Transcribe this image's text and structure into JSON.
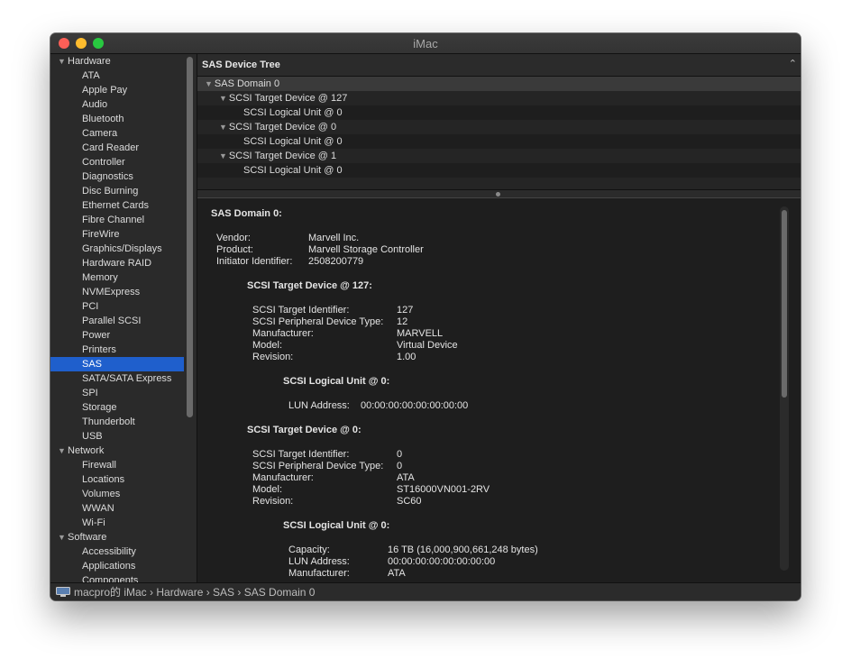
{
  "window": {
    "title": "iMac"
  },
  "sidebar": {
    "rows": [
      {
        "label": "Hardware",
        "group": true
      },
      {
        "label": "ATA"
      },
      {
        "label": "Apple Pay"
      },
      {
        "label": "Audio"
      },
      {
        "label": "Bluetooth"
      },
      {
        "label": "Camera"
      },
      {
        "label": "Card Reader"
      },
      {
        "label": "Controller"
      },
      {
        "label": "Diagnostics"
      },
      {
        "label": "Disc Burning"
      },
      {
        "label": "Ethernet Cards"
      },
      {
        "label": "Fibre Channel"
      },
      {
        "label": "FireWire"
      },
      {
        "label": "Graphics/Displays"
      },
      {
        "label": "Hardware RAID"
      },
      {
        "label": "Memory"
      },
      {
        "label": "NVMExpress"
      },
      {
        "label": "PCI"
      },
      {
        "label": "Parallel SCSI"
      },
      {
        "label": "Power"
      },
      {
        "label": "Printers"
      },
      {
        "label": "SAS",
        "selected": true
      },
      {
        "label": "SATA/SATA Express"
      },
      {
        "label": "SPI"
      },
      {
        "label": "Storage"
      },
      {
        "label": "Thunderbolt"
      },
      {
        "label": "USB"
      },
      {
        "label": "Network",
        "group": true
      },
      {
        "label": "Firewall"
      },
      {
        "label": "Locations"
      },
      {
        "label": "Volumes"
      },
      {
        "label": "WWAN"
      },
      {
        "label": "Wi-Fi"
      },
      {
        "label": "Software",
        "group": true
      },
      {
        "label": "Accessibility"
      },
      {
        "label": "Applications"
      },
      {
        "label": "Components"
      }
    ]
  },
  "tree": {
    "header": "SAS Device Tree",
    "rows": [
      {
        "label": "SAS Domain 0",
        "level": 0,
        "expanded": true
      },
      {
        "label": "SCSI Target Device @ 127",
        "level": 1,
        "expanded": true
      },
      {
        "label": "SCSI Logical Unit @ 0",
        "level": 2
      },
      {
        "label": "SCSI Target Device @ 0",
        "level": 1,
        "expanded": true
      },
      {
        "label": "SCSI Logical Unit @ 0",
        "level": 2
      },
      {
        "label": "SCSI Target Device @ 1",
        "level": 1,
        "expanded": true
      },
      {
        "label": "SCSI Logical Unit @ 0",
        "level": 2
      }
    ]
  },
  "detail": {
    "lines": [
      {
        "text": "SAS Domain 0:",
        "bold": true,
        "indent": 0
      },
      {
        "text": "Vendor:",
        "value": "Marvell Inc.",
        "indent": 1,
        "col": 1
      },
      {
        "text": "Product:",
        "value": "Marvell Storage Controller",
        "indent": 1,
        "col": 1
      },
      {
        "text": "Initiator Identifier:",
        "value": "2508200779",
        "indent": 1,
        "col": 1
      },
      {
        "text": "SCSI Target Device @ 127:",
        "bold": true,
        "indent": 2
      },
      {
        "text": "SCSI Target Identifier:",
        "value": "127",
        "indent": 3,
        "col": 2
      },
      {
        "text": "SCSI Peripheral Device Type:",
        "value": "12",
        "indent": 3,
        "col": 2
      },
      {
        "text": "Manufacturer:",
        "value": "MARVELL",
        "indent": 3,
        "col": 2
      },
      {
        "text": "Model:",
        "value": "Virtual Device",
        "indent": 3,
        "col": 2
      },
      {
        "text": "Revision:",
        "value": "1.00",
        "indent": 3,
        "col": 2
      },
      {
        "text": "SCSI Logical Unit @ 0:",
        "bold": true,
        "indent": 4
      },
      {
        "text": "LUN Address:",
        "value": "00:00:00:00:00:00:00:00",
        "indent": 5,
        "col": 3
      },
      {
        "text": "SCSI Target Device @ 0:",
        "bold": true,
        "indent": 2
      },
      {
        "text": "SCSI Target Identifier:",
        "value": "0",
        "indent": 3,
        "col": 2
      },
      {
        "text": "SCSI Peripheral Device Type:",
        "value": "0",
        "indent": 3,
        "col": 2
      },
      {
        "text": "Manufacturer:",
        "value": "ATA",
        "indent": 3,
        "col": 2
      },
      {
        "text": "Model:",
        "value": "ST16000VN001-2RV",
        "indent": 3,
        "col": 2
      },
      {
        "text": "Revision:",
        "value": "SC60",
        "indent": 3,
        "col": 2
      },
      {
        "text": "SCSI Logical Unit @ 0:",
        "bold": true,
        "indent": 4
      },
      {
        "text": "Capacity:",
        "value": "16 TB (16,000,900,661,248 bytes)",
        "indent": 5,
        "col": 4
      },
      {
        "text": "LUN Address:",
        "value": "00:00:00:00:00:00:00:00",
        "indent": 5,
        "col": 4
      },
      {
        "text": "Manufacturer:",
        "value": "ATA",
        "indent": 5,
        "col": 4
      }
    ]
  },
  "status": {
    "icon": "computer-icon",
    "path": "macpro的 iMac › Hardware › SAS › SAS Domain 0"
  }
}
